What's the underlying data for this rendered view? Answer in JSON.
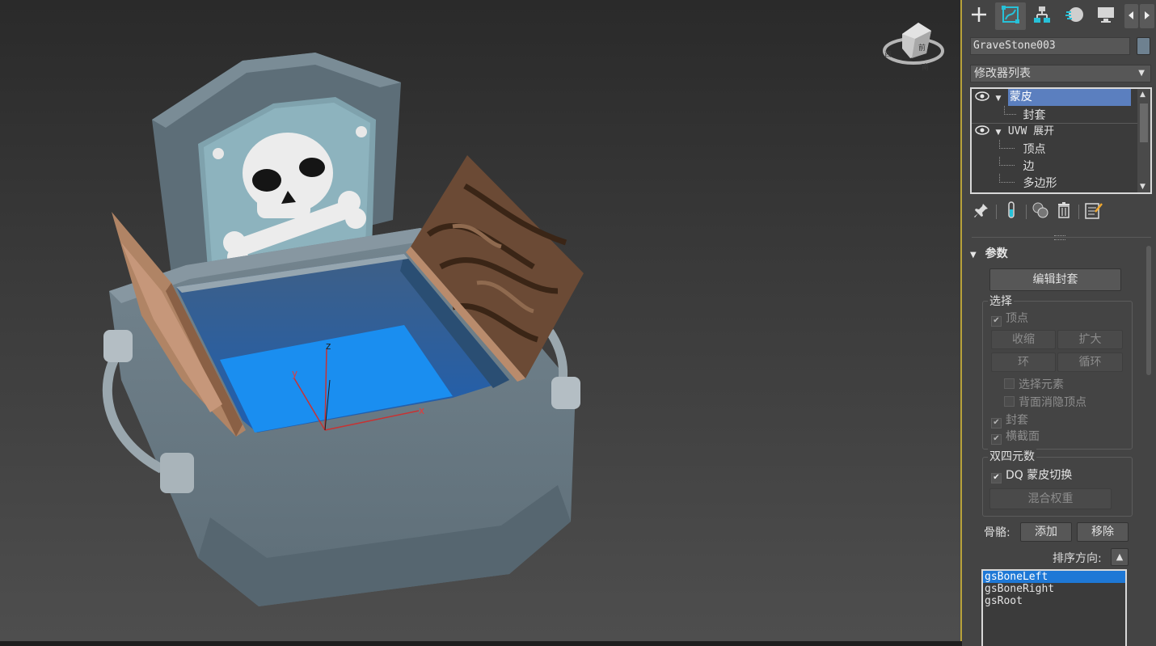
{
  "viewport": {
    "viewcube": {
      "face_label": "前",
      "compass": {
        "w": "西",
        "s": "南"
      }
    },
    "axes": {
      "x": "x",
      "y": "y",
      "z": "z"
    }
  },
  "command_panel": {
    "tabs": [
      {
        "name": "create",
        "icon": "plus-icon"
      },
      {
        "name": "modify",
        "icon": "modify-icon",
        "active": true
      },
      {
        "name": "hierarchy",
        "icon": "hierarchy-icon"
      },
      {
        "name": "motion",
        "icon": "motion-icon"
      },
      {
        "name": "display",
        "icon": "display-icon"
      }
    ],
    "object_name": "GraveStone003",
    "object_color": "#6e8190",
    "modifier_list_label": "修改器列表",
    "stack": [
      {
        "label": "蒙皮",
        "selected": true,
        "expandable": true,
        "visible": true
      },
      {
        "label": "封套",
        "child": true
      },
      {
        "label": "UVW 展开",
        "expandable": true,
        "visible": true
      },
      {
        "label": "顶点",
        "child": true
      },
      {
        "label": "边",
        "child": true
      },
      {
        "label": "多边形",
        "child": true
      }
    ],
    "rollout": {
      "title": "参数",
      "edit_envelopes": "编辑封套",
      "select_group": {
        "title": "选择",
        "vertices": "顶点",
        "shrink": "收缩",
        "grow": "扩大",
        "ring": "环",
        "loop": "循环",
        "select_element": "选择元素",
        "backface_cull": "背面消隐顶点",
        "envelopes": "封套",
        "cross_sections": "横截面"
      },
      "dq_group": {
        "title": "双四元数",
        "dq_toggle": "DQ 蒙皮切换",
        "blend_weights": "混合权重"
      },
      "bones_label": "骨骼:",
      "add": "添加",
      "remove": "移除",
      "sort_label": "排序方向:",
      "bones": [
        "gsBoneLeft",
        "gsBoneRight",
        "gsRoot"
      ],
      "selected_bone": "gsBoneLeft"
    }
  }
}
